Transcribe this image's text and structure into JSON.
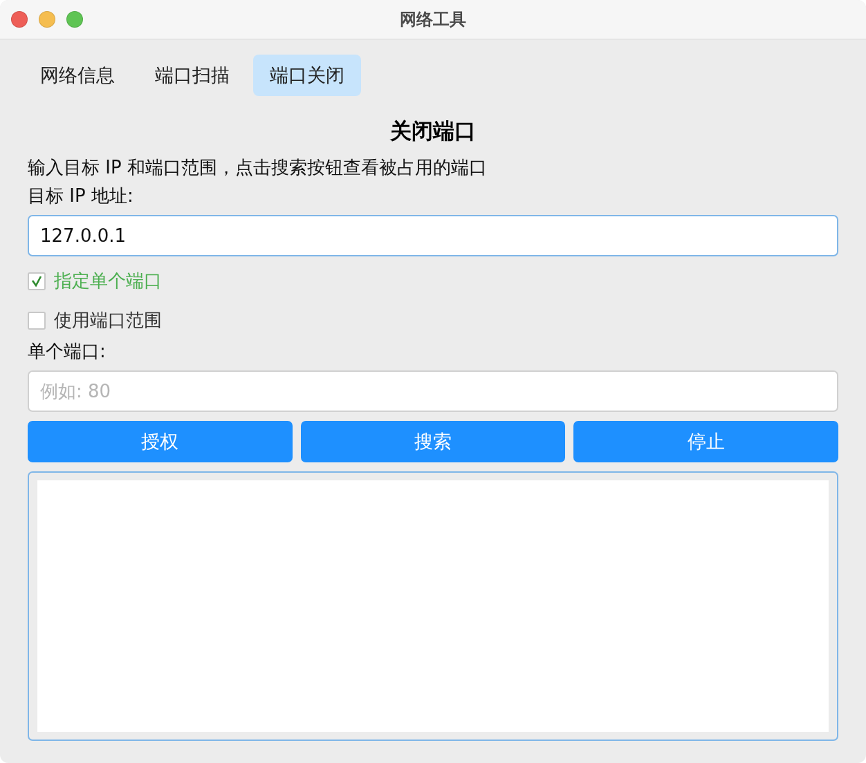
{
  "window": {
    "title": "网络工具"
  },
  "tabs": [
    {
      "label": "网络信息",
      "selected": false
    },
    {
      "label": "端口扫描",
      "selected": false
    },
    {
      "label": "端口关闭",
      "selected": true
    }
  ],
  "heading": "关闭端口",
  "description": "输入目标 IP 和端口范围，点击搜索按钮查看被占用的端口",
  "ip_field": {
    "label": "目标 IP 地址:",
    "value": "127.0.0.1"
  },
  "options": [
    {
      "label": "指定单个端口",
      "checked": true
    },
    {
      "label": "使用端口范围",
      "checked": false
    }
  ],
  "port_field": {
    "label": "单个端口:",
    "placeholder": "例如: 80"
  },
  "buttons": [
    "授权",
    "搜索",
    "停止"
  ]
}
